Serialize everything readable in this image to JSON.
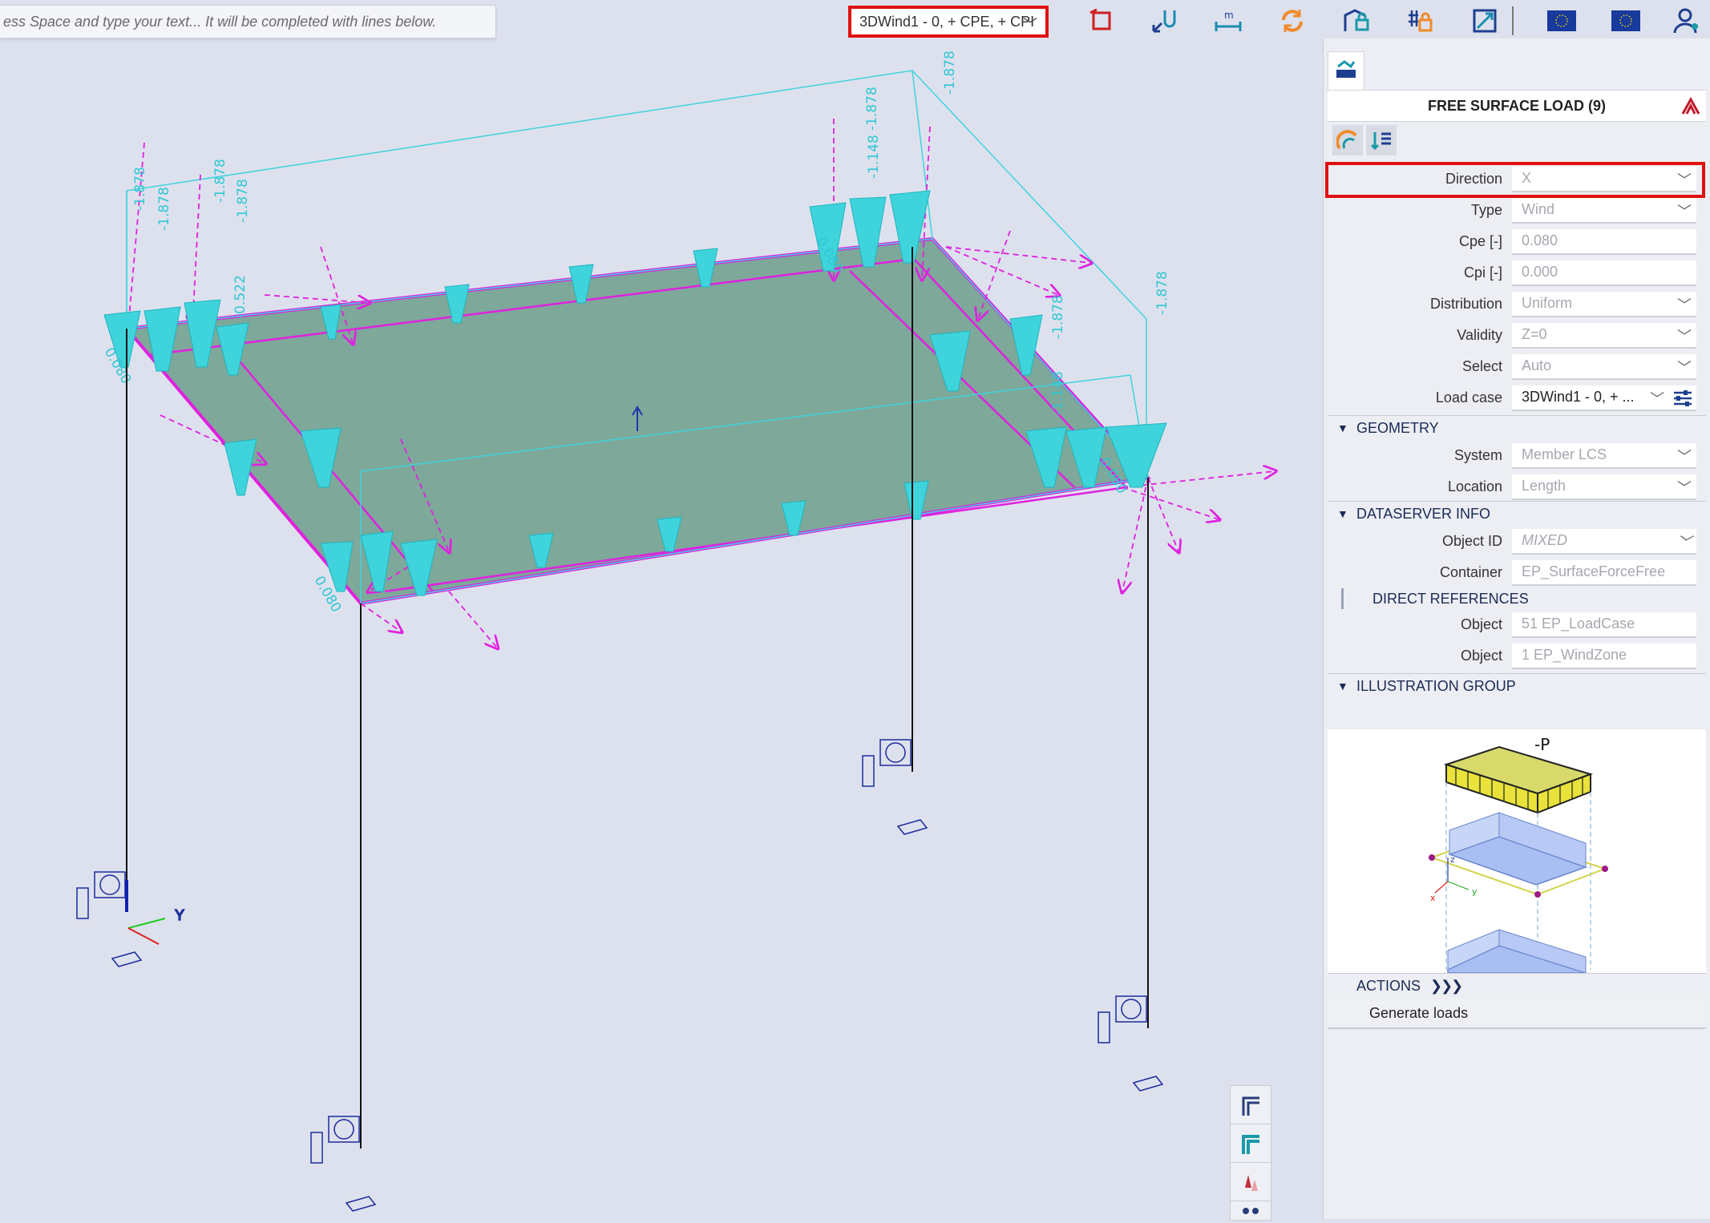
{
  "command_line": {
    "placeholder": "ess Space and type your text... It will be completed with lines below."
  },
  "toolbar": {
    "load_case_combo": "3DWind1 - 0, + CPE, + CPI",
    "icons": [
      "rectangle-select-icon",
      "undo-arrow-icon",
      "measure-icon",
      "refresh-icon",
      "lock-view-icon",
      "grid-lock-icon",
      "zoom-fit-icon",
      "eu-flag-icon",
      "eu-flag-icon",
      "user-icon"
    ]
  },
  "viewport": {
    "labels_top_left": [
      "-1.878",
      "-1.878",
      "-1.878",
      "-1.878"
    ],
    "labels_top_right": [
      "-1.878",
      "-1.878",
      "-1.878",
      "-1.878"
    ],
    "labels_small": [
      "-1.148",
      "-1.148",
      "-0.522"
    ],
    "labels_edge": [
      "0.080",
      "0.080",
      "0.080",
      "0.080"
    ],
    "colors": {
      "wind_load": "#3fd4dc",
      "surface_edge": "#e020e0",
      "surface_fill": "#7da89a",
      "support": "#1d2a9c"
    }
  },
  "panel": {
    "title": "FREE SURFACE LOAD (9)",
    "properties": [
      {
        "label": "Direction",
        "value": "X"
      },
      {
        "label": "Type",
        "value": "Wind"
      },
      {
        "label": "Cpe [-]",
        "value": "0.080"
      },
      {
        "label": "Cpi [-]",
        "value": "0.000"
      },
      {
        "label": "Distribution",
        "value": "Uniform"
      },
      {
        "label": "Validity",
        "value": "Z=0"
      },
      {
        "label": "Select",
        "value": "Auto"
      },
      {
        "label": "Load case",
        "value": "3DWind1 - 0, + ..."
      }
    ],
    "geometry": {
      "header": "GEOMETRY",
      "system_label": "System",
      "system_value": "Member LCS",
      "location_label": "Location",
      "location_value": "Length"
    },
    "dataserver": {
      "header": "DATASERVER INFO",
      "object_id_label": "Object ID",
      "object_id_value": "MIXED",
      "container_label": "Container",
      "container_value": "EP_SurfaceForceFree",
      "direct_refs_header": "DIRECT REFERENCES",
      "object1_label": "Object",
      "object1_value": "51 EP_LoadCase",
      "object2_label": "Object",
      "object2_value": "1 EP_WindZone"
    },
    "illustration": {
      "header": "ILLUSTRATION GROUP",
      "load_label": "-P",
      "axis_z": "z",
      "axis_x": "x",
      "axis_y": "y"
    },
    "actions": {
      "header": "ACTIONS",
      "generate": "Generate loads"
    }
  }
}
